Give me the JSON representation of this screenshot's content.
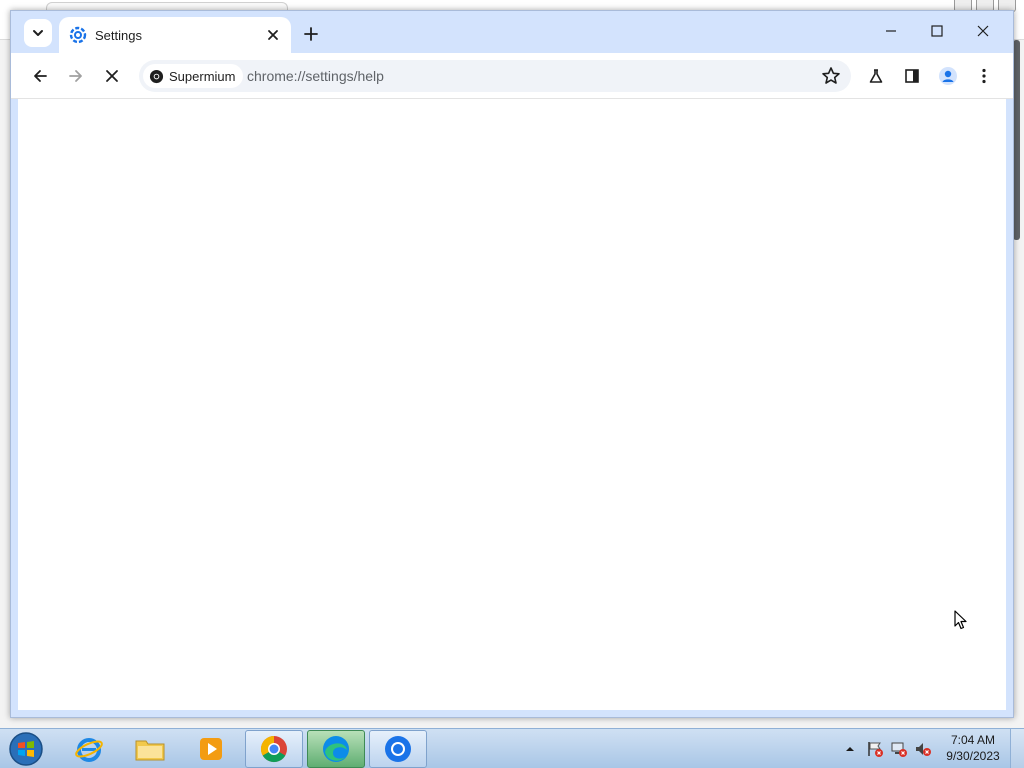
{
  "browser": {
    "tab": {
      "title": "Settings",
      "favicon": "settings-gear-icon"
    },
    "toolbar": {
      "site_chip_label": "Supermium",
      "url": "chrome://settings/help"
    },
    "page_state": "loading"
  },
  "taskbar": {
    "apps": [
      "start-orb",
      "internet-explorer",
      "file-explorer",
      "media-player",
      "google-chrome",
      "microsoft-edge",
      "supermium"
    ],
    "clock": {
      "time": "7:04 AM",
      "date": "9/30/2023"
    }
  },
  "colors": {
    "frame": "#d3e3fd",
    "accent": "#1a73e8",
    "taskbar": "#bcd3ee"
  }
}
